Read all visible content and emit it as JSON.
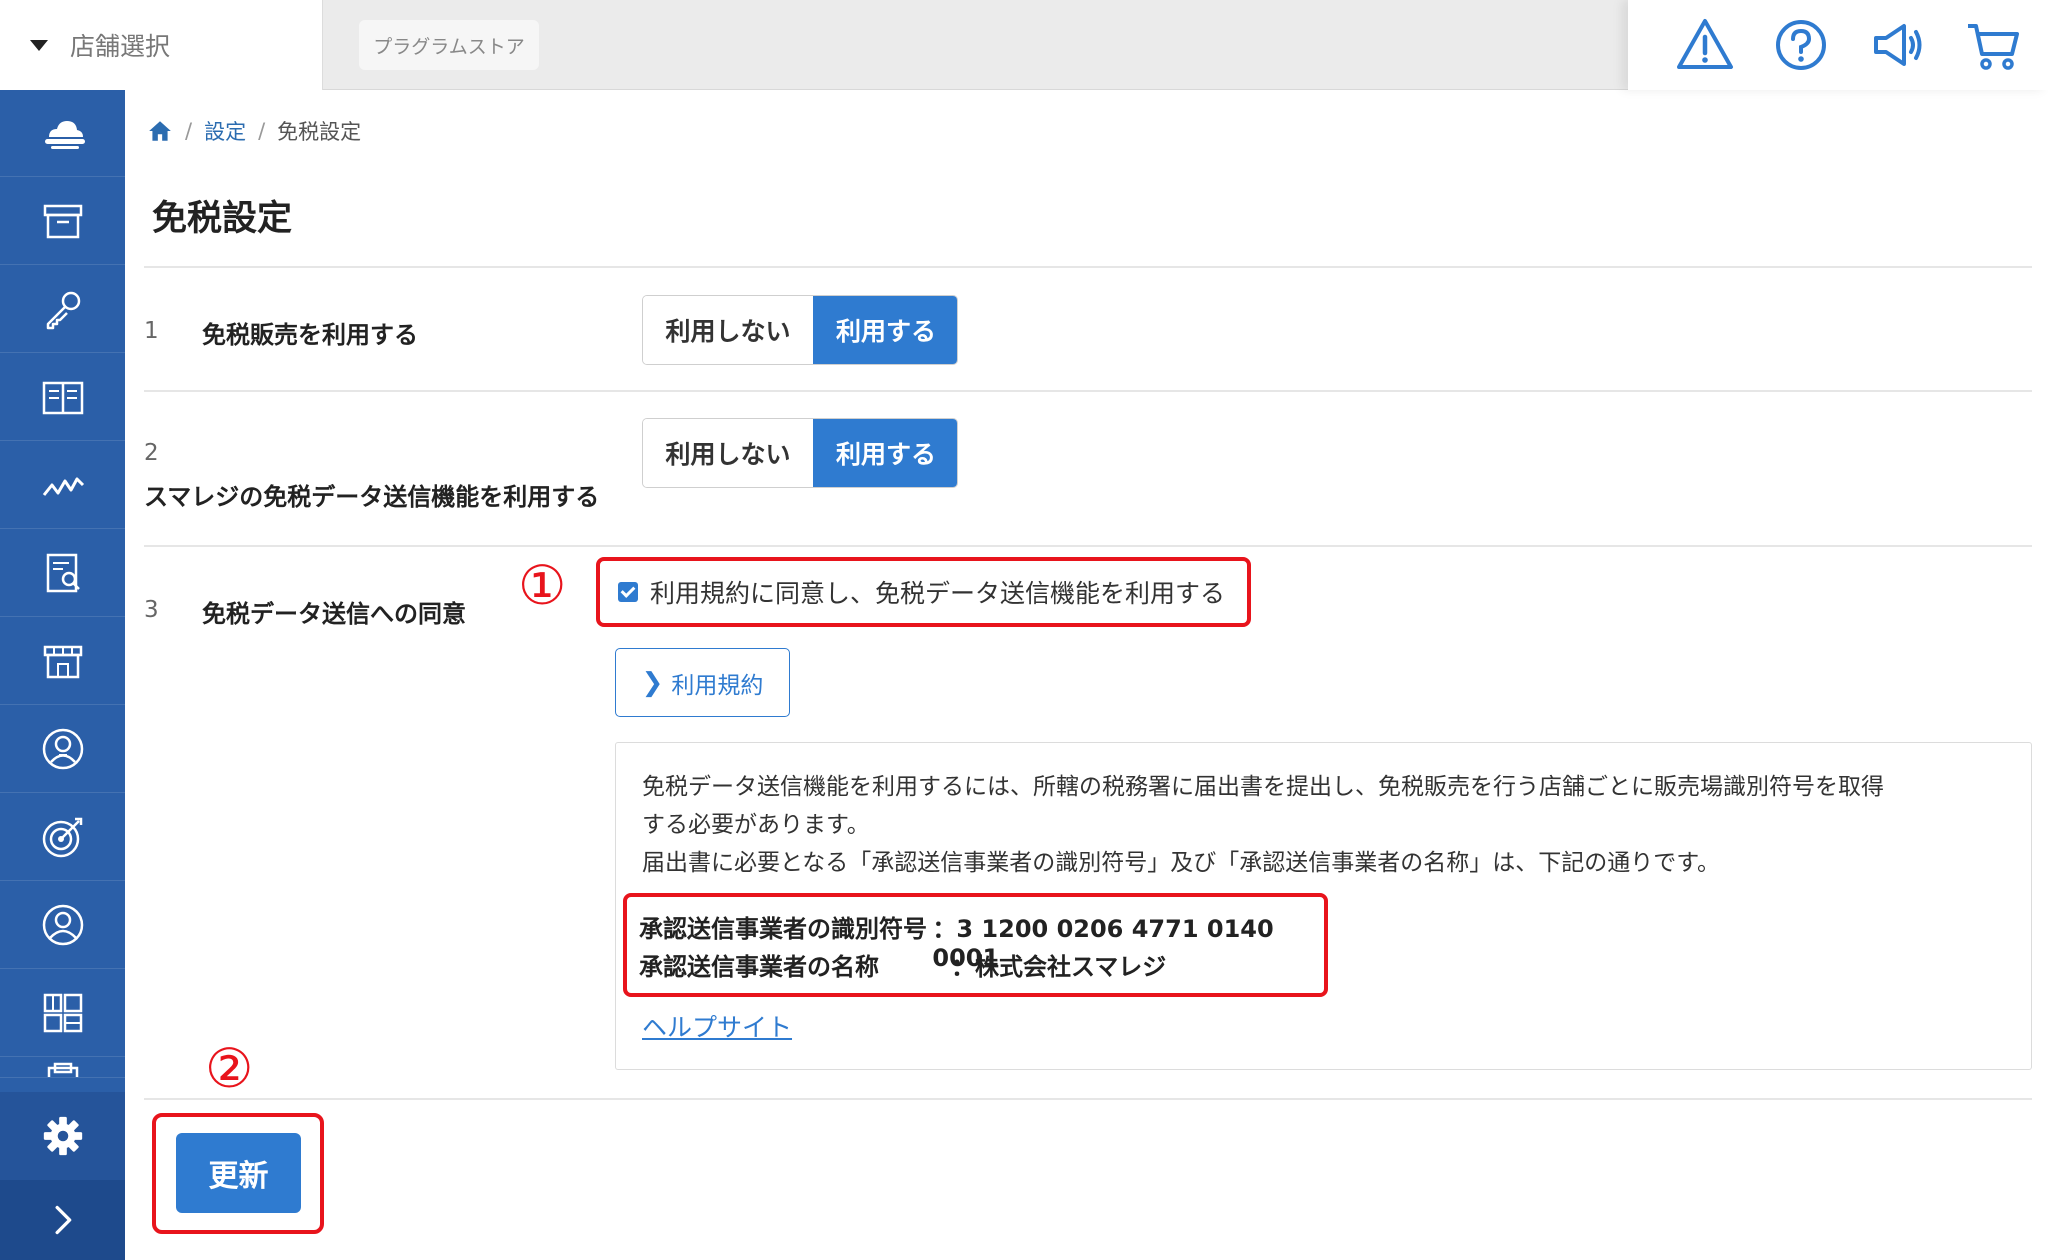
{
  "topbar": {
    "store_select_label": "店舗選択",
    "program_store_label": "プラグラムストア",
    "icons": [
      "alert-icon",
      "help-icon",
      "megaphone-icon",
      "cart-icon"
    ]
  },
  "sidebar": {
    "items": [
      "cloud-icon",
      "archive-icon",
      "key-icon",
      "book-icon",
      "chart-line-icon",
      "report-icon",
      "store-icon",
      "customer-icon",
      "target-icon",
      "user-icon",
      "grid-icon",
      "clipboard-icon"
    ],
    "bottom": [
      "gear-icon",
      "chevron-right-icon"
    ],
    "accent": "#2b5fa8"
  },
  "breadcrumb": {
    "settings": "設定",
    "current": "免税設定"
  },
  "page_title": "免税設定",
  "rows": [
    {
      "num": "1",
      "label": "免税販売を利用する",
      "off_label": "利用しない",
      "on_label": "利用する",
      "selected": "利用する"
    },
    {
      "num": "2",
      "label": "スマレジの免税データ送信機能を利用する",
      "off_label": "利用しない",
      "on_label": "利用する",
      "selected": "利用する"
    },
    {
      "num": "3",
      "label": "免税データ送信への同意"
    }
  ],
  "consent": {
    "checkbox_label": "利用規約に同意し、免税データ送信機能を利用する",
    "checked": true,
    "terms_button": "利用規約"
  },
  "info": {
    "line1": "免税データ送信機能を利用するには、所轄の税務署に届出書を提出し、免税販売を行う店舗ごとに販売場識別符号を取得",
    "line2": "する必要があります。",
    "line3": "届出書に必要となる「承認送信事業者の識別符号」及び「承認送信事業者の名称」は、下記の通りです。",
    "id_key": "承認送信事業者の識別符号",
    "id_value": "：3 1200 0206 4771 0140 0001",
    "name_key": "承認送信事業者の名称",
    "name_value": "：株式会社スマレジ",
    "help_link": "ヘルプサイト"
  },
  "annotations": {
    "mark1": "①",
    "mark2": "②",
    "color": "#e8141c"
  },
  "update_button": "更新",
  "colors": {
    "primary": "#2f7bd0",
    "highlight": "#e8141c"
  }
}
